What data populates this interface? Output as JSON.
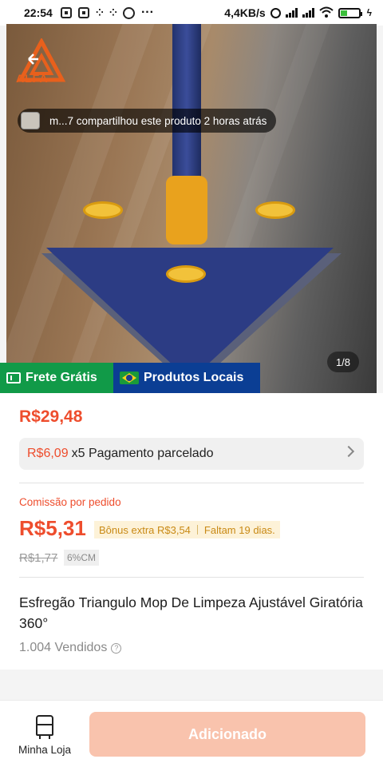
{
  "status_bar": {
    "time": "22:54",
    "net_speed": "4,4KB/s",
    "icons": [
      "notification-icon",
      "notification-icon",
      "app-icon",
      "app-icon",
      "pinterest-icon",
      "more-dots-icon",
      "alarm-icon",
      "signal-icon",
      "signal-icon",
      "wifi-icon",
      "battery-icon",
      "charging-icon"
    ]
  },
  "hero": {
    "logo_text": "ALFA",
    "share_text": "m...7 compartilhou este produto 2 horas atrás",
    "counter": "1/8"
  },
  "badges": {
    "frete": "Frete Grátis",
    "local": "Produtos Locais"
  },
  "product": {
    "price": "R$29,48",
    "installment_amount": "R$6,09",
    "installment_text": "x5 Pagamento parcelado",
    "commission_label": "Comissão por pedido",
    "commission_value": "R$5,31",
    "bonus_text": "Bônus extra R$3,54",
    "bonus_days": "Faltam 19 dias.",
    "old_commission": "R$1,77",
    "commission_pct": "6%CM",
    "title": "Esfregão Triangulo Mop De Limpeza Ajustável Giratória 360°",
    "sold": "1.004 Vendidos"
  },
  "bottom_bar": {
    "store_label": "Minha Loja",
    "add_button": "Adicionado"
  },
  "colors": {
    "accent": "#ee4d2d",
    "free_shipping": "#119a48",
    "local_products": "#0b3e94",
    "added_button": "#f9c3ad"
  }
}
